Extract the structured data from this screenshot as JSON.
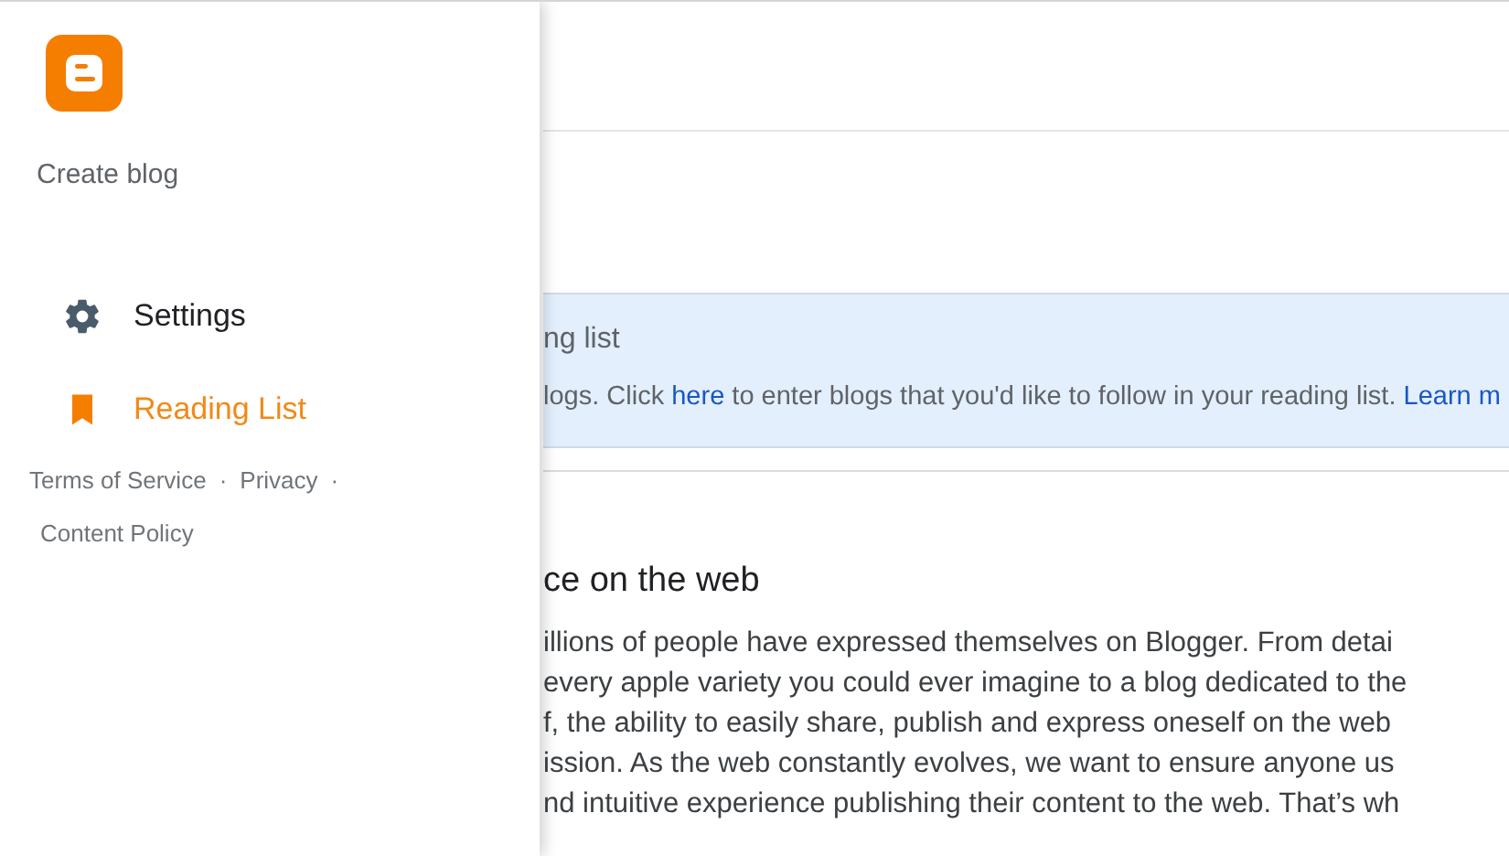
{
  "drawer": {
    "create_label": "Create blog",
    "items": [
      {
        "label": "Settings",
        "kind": "gear",
        "selected": false
      },
      {
        "label": "Reading List",
        "kind": "bookmark",
        "selected": true
      }
    ],
    "footer_links": [
      "Terms of Service",
      "Privacy",
      "Content Policy"
    ],
    "separator": "·"
  },
  "banner": {
    "title": "ng list",
    "text_before": "logs. Click ",
    "link": "here",
    "text_after": " to enter blogs that you'd like to follow in your reading list. ",
    "link_2": "Learn m"
  },
  "section": {
    "heading": "ce on the web",
    "lines": [
      "illions of people have expressed themselves on Blogger. From detai",
      "every apple variety you could ever imagine to a blog dedicated to the",
      "f, the ability to easily share, publish and express oneself on the web",
      "ission. As the web constantly evolves, we want to ensure anyone us",
      "nd intuitive experience publishing their content to the web. That’s wh"
    ]
  }
}
